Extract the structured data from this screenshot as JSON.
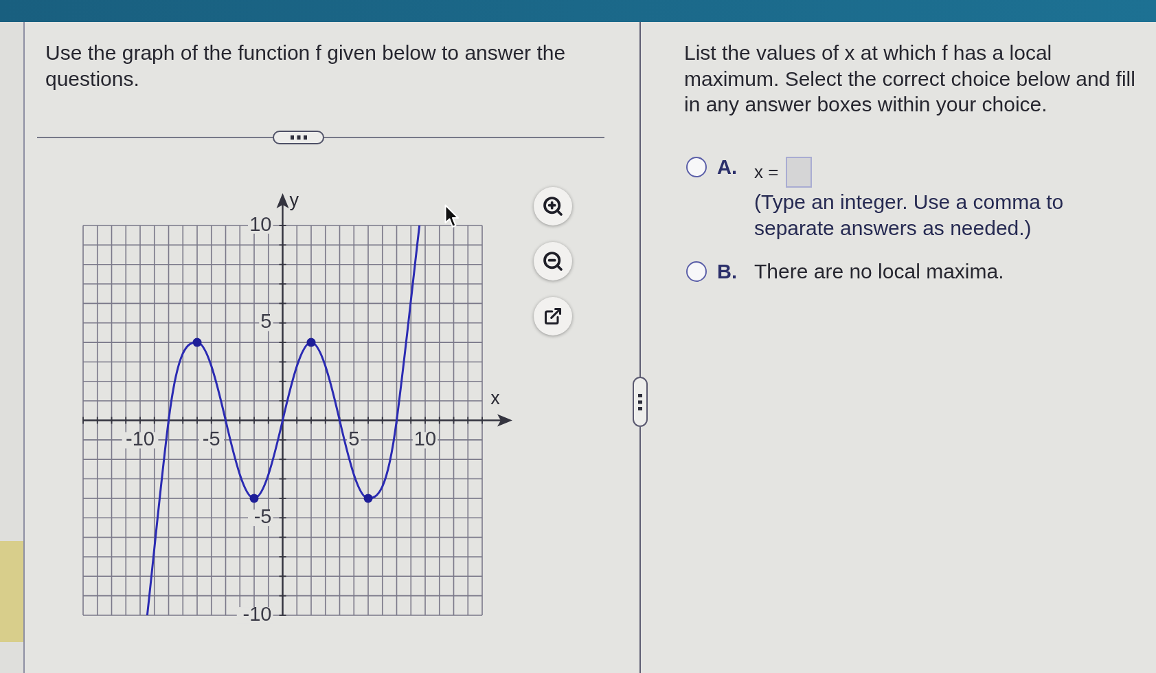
{
  "question_panel": {
    "prompt": "Use the graph of the function f given below to answer the questions.",
    "graph": {
      "chart_data": [
        {
          "type": "line",
          "xlabel": "x",
          "ylabel": "y",
          "xlim": [
            -14,
            14
          ],
          "ylim": [
            -10,
            10
          ],
          "xticks": [
            -10,
            -5,
            5,
            10
          ],
          "yticks": [
            10,
            5,
            -5,
            -10
          ],
          "grid": true,
          "series": [
            {
              "type": "line",
              "color": "#2b2bb3",
              "x": [
                -9.5,
                -8,
                -6,
                -4,
                -2,
                0,
                2,
                4,
                6,
                8,
                9.6
              ],
              "values": [
                -10,
                0,
                4,
                0,
                -4,
                0,
                4,
                0,
                -4,
                0,
                10
              ]
            },
            {
              "type": "scatter",
              "color": "#1e1e98",
              "x": [
                -6,
                -2,
                2,
                6
              ],
              "values": [
                4,
                -4,
                4,
                -4
              ]
            }
          ]
        }
      ]
    }
  },
  "answer_panel": {
    "question": "List the values of x at which f has a local maximum. Select the correct choice below and fill in any answer boxes within your choice.",
    "choices": [
      {
        "kind": "input",
        "letter": "A.",
        "selected": false,
        "prefix": "x =",
        "hint": "(Type an integer. Use a comma to separate answers as needed.)"
      },
      {
        "kind": "statement",
        "letter": "B.",
        "selected": false,
        "text": "There are no local maxima."
      }
    ]
  }
}
